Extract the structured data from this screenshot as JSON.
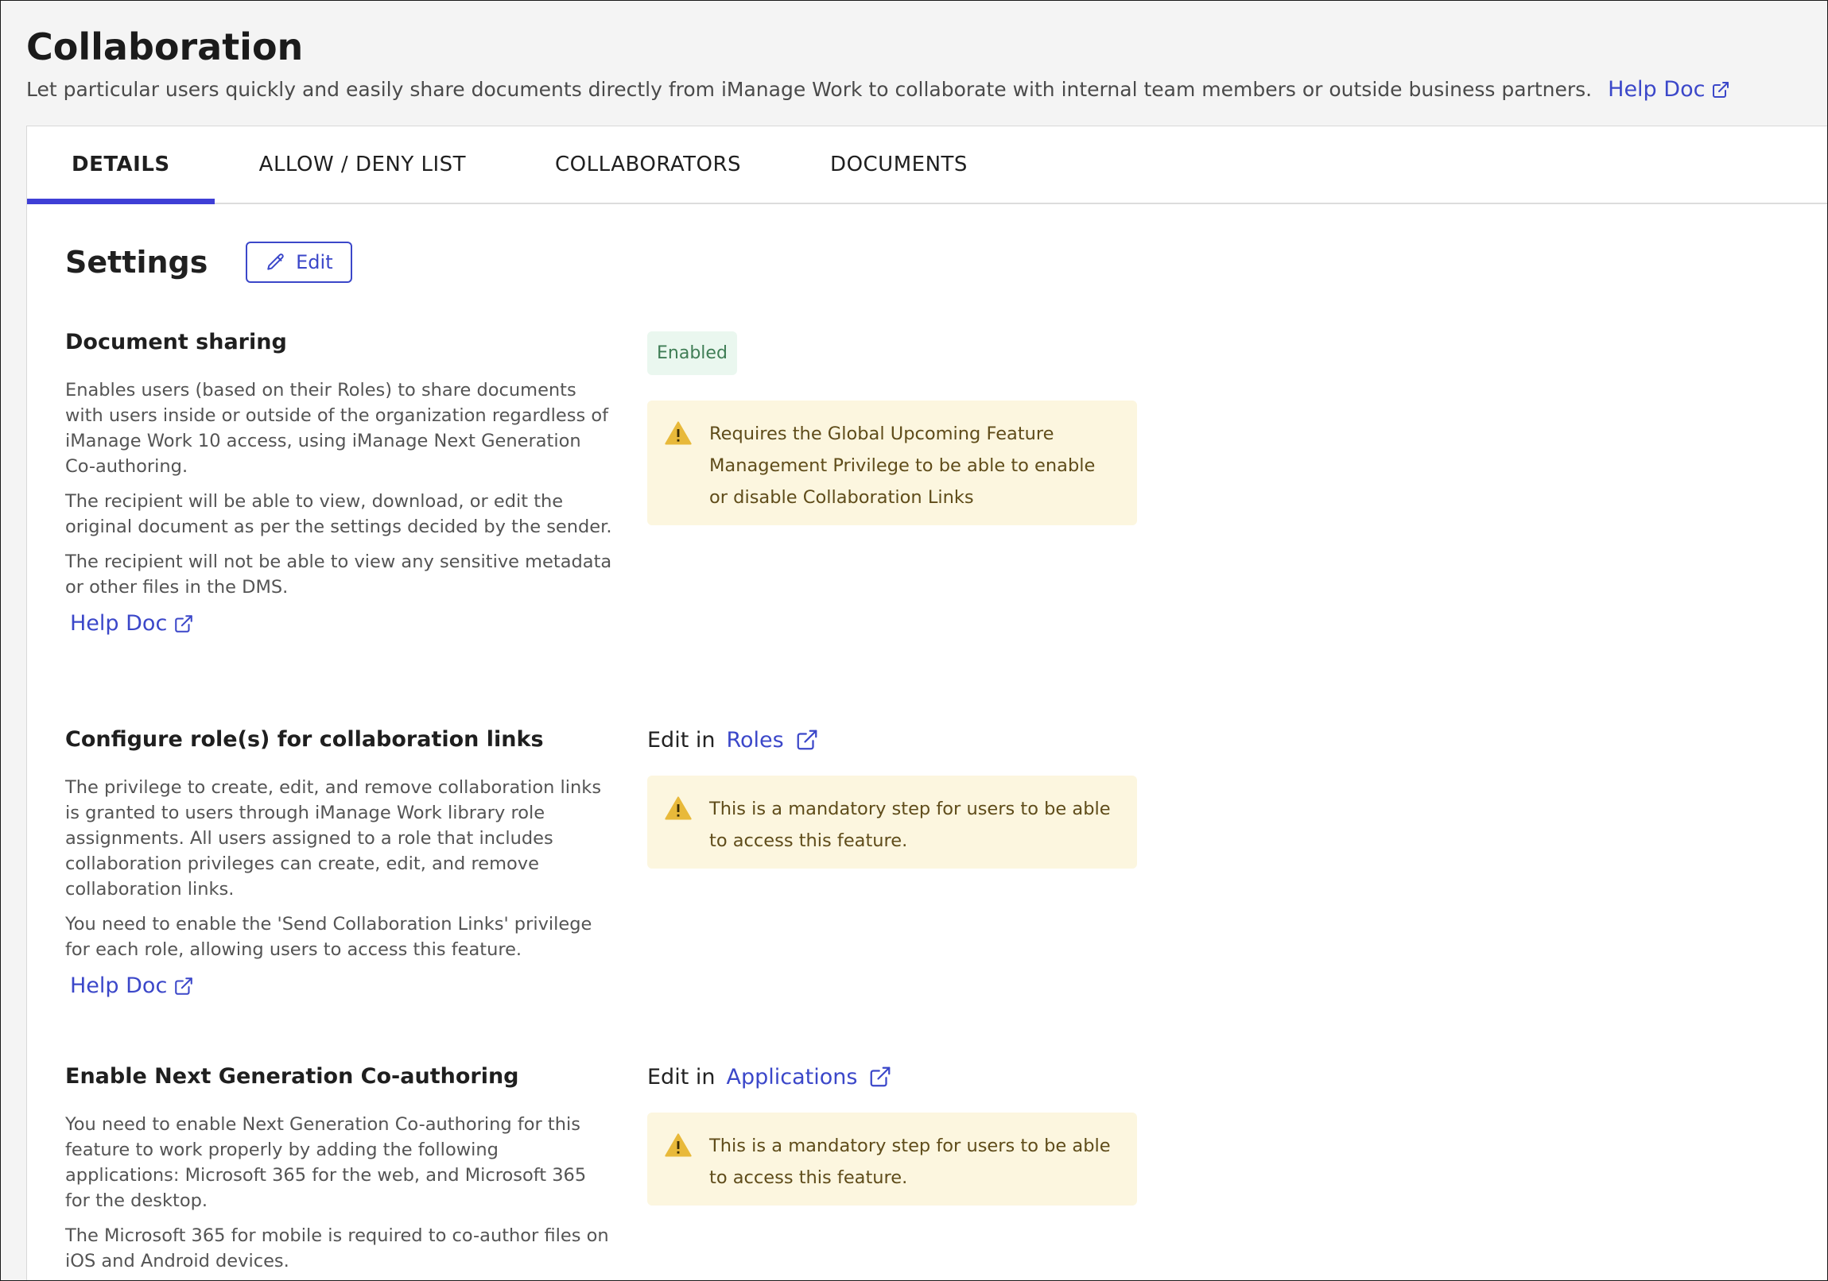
{
  "header": {
    "title": "Collaboration",
    "subtitle": "Let particular users quickly and easily share documents directly from iManage Work to collaborate with internal team members or outside business partners.",
    "help_label": "Help Doc"
  },
  "tabs": [
    {
      "label": "DETAILS",
      "active": true
    },
    {
      "label": "ALLOW / DENY LIST",
      "active": false
    },
    {
      "label": "COLLABORATORS",
      "active": false
    },
    {
      "label": "DOCUMENTS",
      "active": false
    }
  ],
  "settings": {
    "title": "Settings",
    "edit_label": "Edit"
  },
  "sections": {
    "document_sharing": {
      "title": "Document sharing",
      "paragraphs": [
        "Enables users (based on their Roles) to share documents with users inside or outside of the organization regardless of iManage Work 10 access, using iManage Next Generation Co-authoring.",
        "The recipient will be able to view, download, or edit the original document as per the settings decided by the sender.",
        "The recipient will not be able to view any sensitive metadata or other files in the DMS."
      ],
      "help_label": "Help Doc",
      "status": "Enabled",
      "warning": "Requires the Global Upcoming Feature Management Privilege to be able to enable or disable Collaboration Links"
    },
    "configure_roles": {
      "title": "Configure role(s) for collaboration links",
      "paragraphs": [
        "The privilege to create, edit, and remove collaboration links is granted to users through iManage Work library role assignments. All users assigned to a role that includes collaboration privileges can create, edit, and remove collaboration links.",
        "You need to enable the 'Send Collaboration Links' privilege for each role, allowing users to access this feature."
      ],
      "help_label": "Help Doc",
      "edit_in_label": "Edit in",
      "edit_in_link": "Roles",
      "warning": "This is a mandatory step for users to be able to access this feature."
    },
    "co_authoring": {
      "title": "Enable Next Generation Co-authoring",
      "paragraphs": [
        "You need to enable Next Generation Co-authoring for this feature to work properly by adding the following applications: Microsoft 365 for the web, and Microsoft 365 for the desktop.",
        "The Microsoft 365 for mobile is required to co-author files on iOS and Android devices."
      ],
      "edit_in_label": "Edit in",
      "edit_in_link": "Applications",
      "warning": "This is a mandatory step for users to be able to access this feature."
    }
  },
  "colors": {
    "accent": "#3b47c9",
    "tab_indicator": "#3f3fd6",
    "enabled_bg": "#eaf7ef",
    "enabled_text": "#3f7d55",
    "warning_bg": "#fcf6df",
    "warning_icon": "#e8b93a"
  }
}
